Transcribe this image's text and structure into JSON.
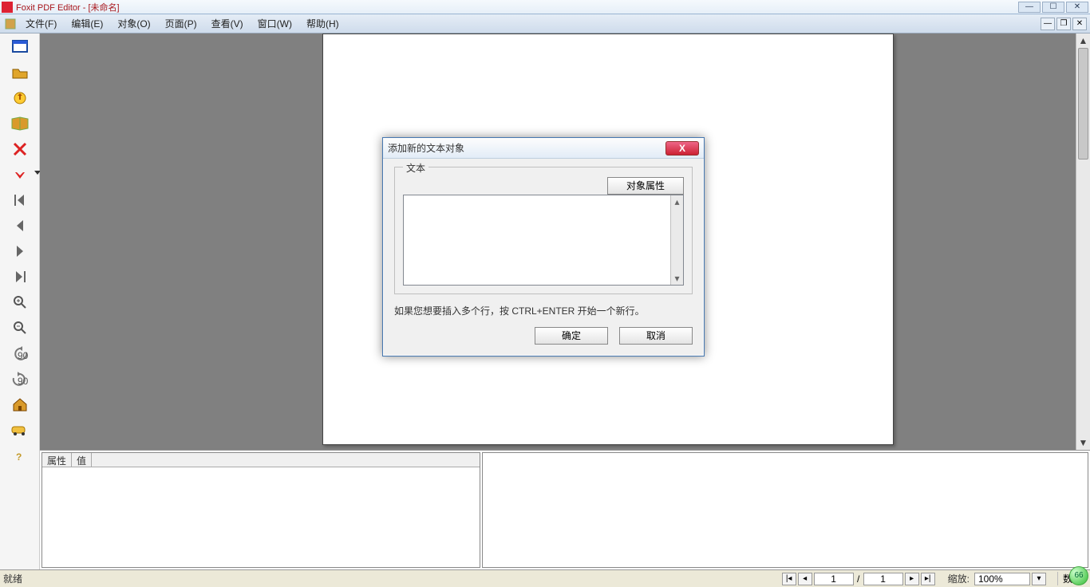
{
  "app": {
    "title": "Foxit PDF Editor - [未命名]"
  },
  "menu": {
    "file": "文件(F)",
    "edit": "编辑(E)",
    "object": "对象(O)",
    "page": "页面(P)",
    "view": "查看(V)",
    "window": "窗口(W)",
    "help": "帮助(H)"
  },
  "toolbar_icons": {
    "new": "new-file-icon",
    "open": "open-folder-icon",
    "export": "export-icon",
    "book": "book-icon",
    "delete": "delete-icon",
    "import": "import-arrow-icon",
    "first": "first-page-icon",
    "prev": "prev-page-icon",
    "next": "next-page-icon",
    "last": "last-page-icon",
    "zoomin": "zoom-in-icon",
    "zoomout": "zoom-out-icon",
    "rotl": "rotate-left-icon",
    "rotr": "rotate-right-icon",
    "home": "home-icon",
    "car": "object-icon",
    "helpq": "help-icon"
  },
  "panel": {
    "col_property": "属性",
    "col_value": "值"
  },
  "status": {
    "ready": "就绪",
    "page_current": "1",
    "page_sep": "/",
    "page_total": "1",
    "zoom_label": "缩放:",
    "zoom_value": "100%",
    "num_label": "数字",
    "badge": "66"
  },
  "dialog": {
    "title": "添加新的文本对象",
    "group_legend": "文本",
    "prop_btn": "对象属性",
    "text_value": "",
    "hint": "如果您想要插入多个行，按 CTRL+ENTER 开始一个新行。",
    "ok": "确定",
    "cancel": "取消",
    "close_x": "X"
  }
}
